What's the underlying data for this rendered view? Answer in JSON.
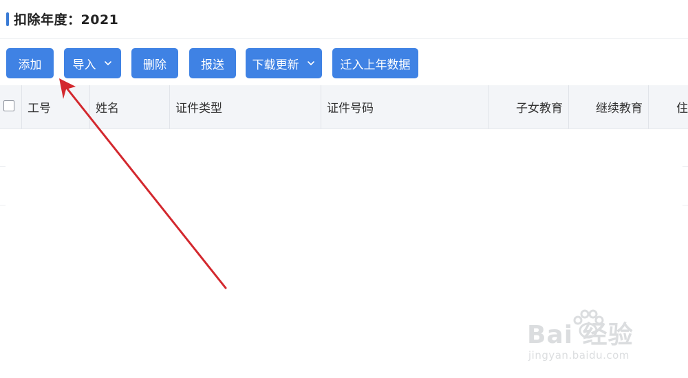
{
  "header": {
    "title": "扣除年度：2021"
  },
  "toolbar": {
    "add_label": "添加",
    "import_label": "导入",
    "delete_label": "删除",
    "submit_label": "报送",
    "download_update_label": "下载更新",
    "migrate_last_year_label": "迁入上年数据"
  },
  "table": {
    "columns": [
      "工号",
      "姓名",
      "证件类型",
      "证件号码",
      "子女教育",
      "继续教育",
      "住"
    ],
    "rows": []
  },
  "colors": {
    "button": "#3f82e4",
    "accent": "#3a7bd5",
    "annotation_arrow": "#d3282e"
  },
  "watermark": {
    "brand": "Bai 经验",
    "url": "jingyan.baidu.com"
  }
}
